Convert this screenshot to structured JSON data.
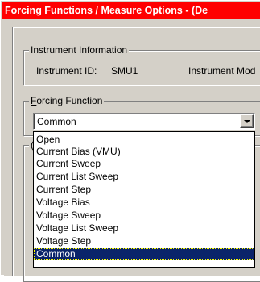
{
  "window": {
    "title": "Forcing Functions / Measure Options - (De"
  },
  "instrument_info": {
    "legend": "Instrument Information",
    "id_label": "Instrument ID:",
    "id_value": "SMU1",
    "model_label": "Instrument Mod"
  },
  "forcing_function": {
    "legend_accel": "F",
    "legend_rest": "orcing Function",
    "selected_value": "Common",
    "options": [
      "Open",
      "Current Bias (VMU)",
      "Current Sweep",
      "Current List Sweep",
      "Current Step",
      "Voltage Bias",
      "Voltage Sweep",
      "Voltage List Sweep",
      "Voltage Step",
      "Common"
    ],
    "highlighted_index": 9
  },
  "third_group": {
    "legend_partial": "("
  },
  "colors": {
    "titlebar": "#ff0000",
    "face": "#d4d0c8",
    "selection": "#0a246a"
  }
}
